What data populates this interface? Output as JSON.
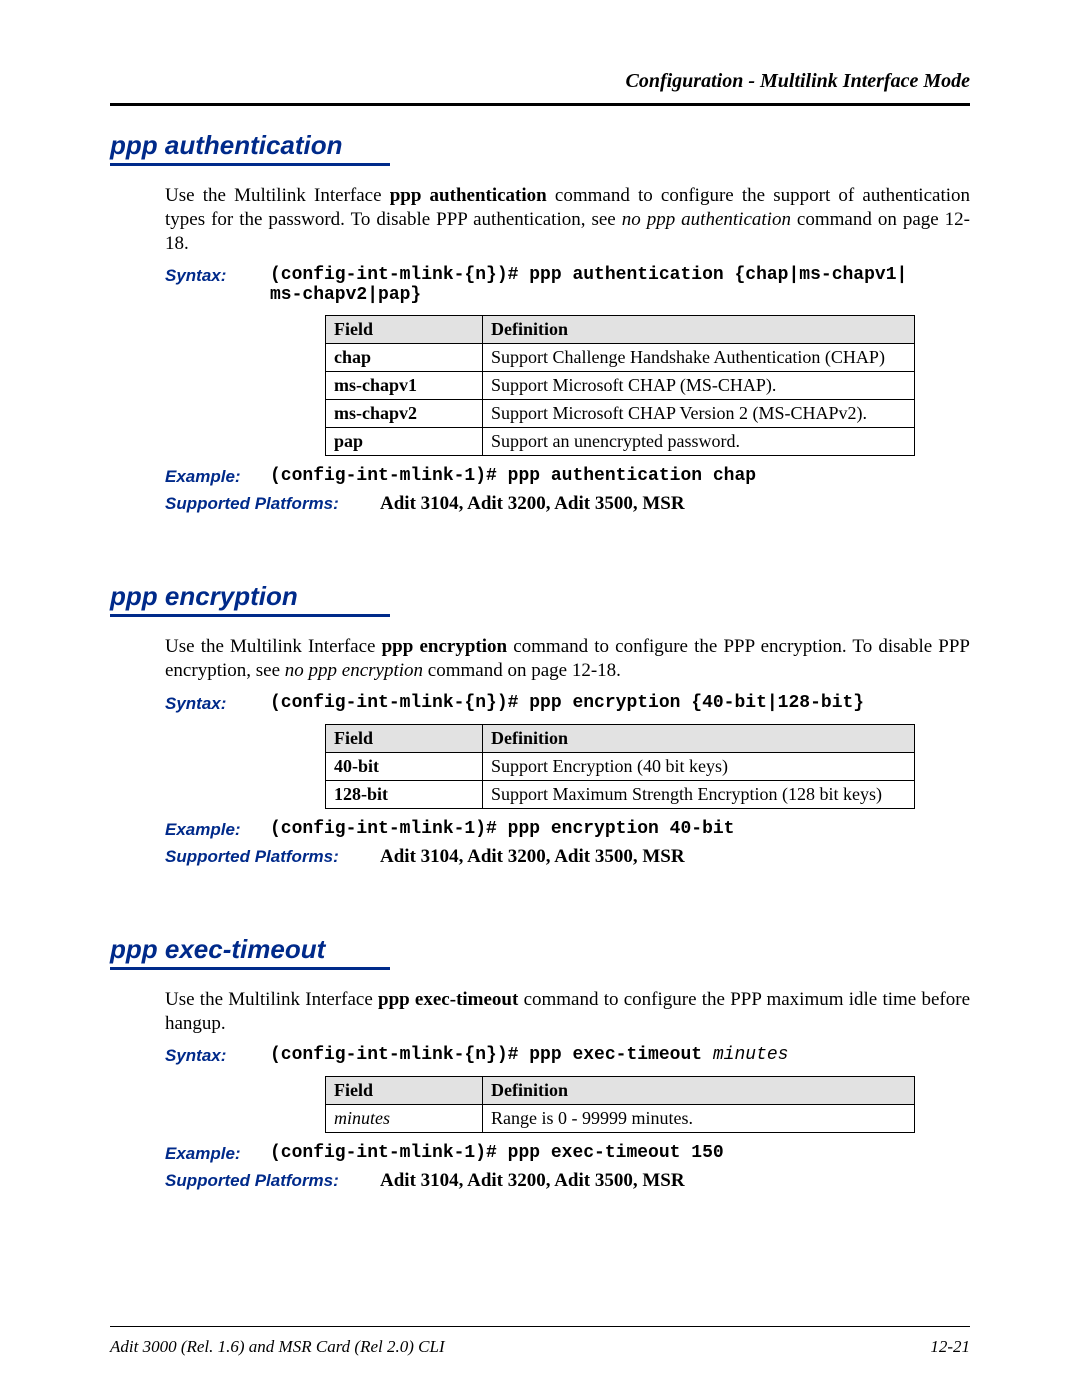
{
  "header": {
    "running": "Configuration - Multilink Interface Mode"
  },
  "sections": {
    "auth": {
      "title": "ppp authentication",
      "intro_parts": {
        "p1": "Use the Multilink Interface ",
        "bold1": "ppp authentication",
        "p2": " command to configure the support of authentication types for the password. To disable PPP authentication, see ",
        "ital1": "no ppp authentication",
        "p3": " command on page 12-18."
      },
      "syntax_label": "Syntax:",
      "syntax_code": "(config-int-mlink-{n})# ppp authentication {chap|ms-chapv1|\nms-chapv2|pap}",
      "table": {
        "headers": [
          "Field",
          "Definition"
        ],
        "rows": [
          {
            "field": "chap",
            "def": "Support Challenge Handshake Authentication (CHAP)"
          },
          {
            "field": "ms-chapv1",
            "def": "Support Microsoft CHAP (MS-CHAP)."
          },
          {
            "field": "ms-chapv2",
            "def": "Support Microsoft CHAP Version 2 (MS-CHAPv2)."
          },
          {
            "field": "pap",
            "def": "Support an unencrypted password."
          }
        ]
      },
      "example_label": "Example:",
      "example_code": "(config-int-mlink-1)# ppp authentication chap",
      "platforms_label": "Supported Platforms:",
      "platforms_value": "Adit 3104, Adit 3200, Adit 3500, MSR"
    },
    "enc": {
      "title": "ppp encryption",
      "intro_parts": {
        "p1": "Use the Multilink Interface ",
        "bold1": "ppp encryption",
        "p2": " command to configure the PPP encryption. To disable PPP encryption, see ",
        "ital1": "no ppp encryption",
        "p3": " command on page 12-18."
      },
      "syntax_label": "Syntax:",
      "syntax_code": "(config-int-mlink-{n})# ppp encryption {40-bit|128-bit}",
      "table": {
        "headers": [
          "Field",
          "Definition"
        ],
        "rows": [
          {
            "field": "40-bit",
            "def": "Support Encryption (40 bit keys)"
          },
          {
            "field": "128-bit",
            "def": "Support Maximum Strength Encryption (128 bit keys)"
          }
        ]
      },
      "example_label": "Example:",
      "example_code": "(config-int-mlink-1)# ppp encryption 40-bit",
      "platforms_label": "Supported Platforms:",
      "platforms_value": "Adit 3104, Adit 3200, Adit 3500, MSR"
    },
    "exec": {
      "title": "ppp exec-timeout",
      "intro_parts": {
        "p1": "Use the Multilink Interface ",
        "bold1": "ppp exec-timeout",
        "p2": " command to configure the PPP maximum idle time before hangup."
      },
      "syntax_label": "Syntax:",
      "syntax_code_pre": "(config-int-mlink-{n})# ppp exec-timeout ",
      "syntax_code_var": "minutes",
      "table": {
        "headers": [
          "Field",
          "Definition"
        ],
        "rows": [
          {
            "field": "minutes",
            "field_ital": true,
            "def": "Range is 0 - 99999 minutes."
          }
        ]
      },
      "example_label": "Example:",
      "example_code": "(config-int-mlink-1)# ppp exec-timeout 150",
      "platforms_label": "Supported Platforms:",
      "platforms_value": "Adit 3104, Adit 3200, Adit 3500, MSR"
    }
  },
  "footer": {
    "left": "Adit 3000 (Rel. 1.6) and MSR Card (Rel 2.0) CLI",
    "right": "12-21"
  }
}
